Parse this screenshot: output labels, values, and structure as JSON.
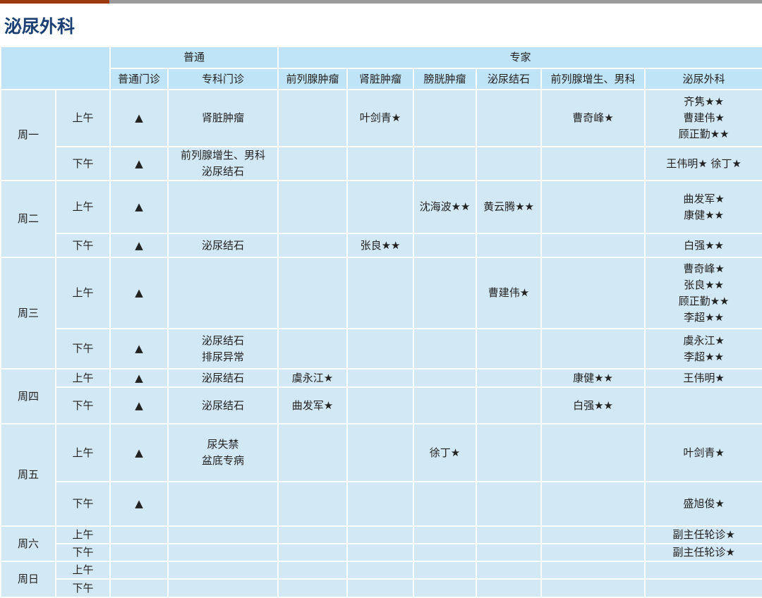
{
  "title": "泌尿外科",
  "header": {
    "group_general": "普通",
    "group_expert": "专家",
    "columns": [
      "普通门诊",
      "专科门诊",
      "前列腺肿瘤",
      "肾脏肿瘤",
      "膀胱肿瘤",
      "泌尿结石",
      "前列腺增生、男科",
      "泌尿外科"
    ]
  },
  "days": [
    {
      "day": "周一",
      "rows": [
        {
          "period": "上午",
          "cells": [
            "▲",
            "肾脏肿瘤",
            "",
            "叶剑青★",
            "",
            "",
            "曹奇峰★",
            "齐隽★★\n曹建伟★\n顾正勤★★"
          ]
        },
        {
          "period": "下午",
          "cells": [
            "▲",
            "前列腺增生、男科\n泌尿结石",
            "",
            "",
            "",
            "",
            "",
            "王伟明★  徐丁★"
          ]
        }
      ]
    },
    {
      "day": "周二",
      "rows": [
        {
          "period": "上午",
          "cells": [
            "▲",
            "",
            "",
            "",
            "沈海波★★",
            "黄云腾★★",
            "",
            "曲发军★\n康健★★"
          ]
        },
        {
          "period": "下午",
          "cells": [
            "▲",
            "泌尿结石",
            "",
            "张良★★",
            "",
            "",
            "",
            "白强★★"
          ]
        }
      ]
    },
    {
      "day": "周三",
      "rows": [
        {
          "period": "上午",
          "cells": [
            "▲",
            "",
            "",
            "",
            "",
            "曹建伟★",
            "",
            "曹奇峰★\n张良★★\n顾正勤★★\n李超★★"
          ]
        },
        {
          "period": "下午",
          "cells": [
            "▲",
            "泌尿结石\n排尿异常",
            "",
            "",
            "",
            "",
            "",
            "虞永江★\n李超★★"
          ]
        }
      ]
    },
    {
      "day": "周四",
      "rows": [
        {
          "period": "上午",
          "cells": [
            "▲",
            "泌尿结石",
            "虞永江★",
            "",
            "",
            "",
            "康健★★",
            "王伟明★"
          ]
        },
        {
          "period": "下午",
          "cells": [
            "▲",
            "泌尿结石",
            "曲发军★",
            "",
            "",
            "",
            "白强★★",
            ""
          ]
        }
      ]
    },
    {
      "day": "周五",
      "rows": [
        {
          "period": "上午",
          "cells": [
            "▲",
            "尿失禁\n盆底专病",
            "",
            "",
            "徐丁★",
            "",
            "",
            "叶剑青★"
          ]
        },
        {
          "period": "下午",
          "cells": [
            "▲",
            "",
            "",
            "",
            "",
            "",
            "",
            "盛旭俊★"
          ]
        }
      ]
    },
    {
      "day": "周六",
      "rows": [
        {
          "period": "上午",
          "cells": [
            "",
            "",
            "",
            "",
            "",
            "",
            "",
            "副主任轮诊★"
          ]
        },
        {
          "period": "下午",
          "cells": [
            "",
            "",
            "",
            "",
            "",
            "",
            "",
            "副主任轮诊★"
          ]
        }
      ]
    },
    {
      "day": "周日",
      "rows": [
        {
          "period": "上午",
          "cells": [
            "",
            "",
            "",
            "",
            "",
            "",
            "",
            ""
          ]
        },
        {
          "period": "下午",
          "cells": [
            "",
            "",
            "",
            "",
            "",
            "",
            "",
            ""
          ]
        }
      ]
    }
  ]
}
